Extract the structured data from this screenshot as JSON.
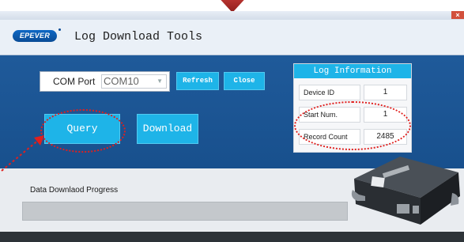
{
  "window": {
    "close_glyph": "×"
  },
  "header": {
    "logo_text": "EPEVER",
    "title": "Log Download Tools"
  },
  "connection": {
    "com_port_label": "COM Port",
    "com_port_value": "COM10",
    "refresh_label": "Refresh",
    "close_label": "Close"
  },
  "actions": {
    "query_label": "Query",
    "download_label": "Download"
  },
  "log_info": {
    "title": "Log Information",
    "rows": [
      {
        "label": "Device ID",
        "value": "1"
      },
      {
        "label": "Start Num.",
        "value": "1"
      },
      {
        "label": "Record Count",
        "value": "2485"
      }
    ]
  },
  "progress": {
    "label": "Data Downlaod Progress",
    "fraction": 0.0
  },
  "colors": {
    "panel_blue": "#1f5a9a",
    "button_cyan": "#1eb4e8",
    "annotation_red": "#e0201e",
    "marker_red": "#c83c38"
  },
  "icons": {
    "dropdown": "chevron-down-icon",
    "annotation_arrow": "arrow-icon"
  }
}
